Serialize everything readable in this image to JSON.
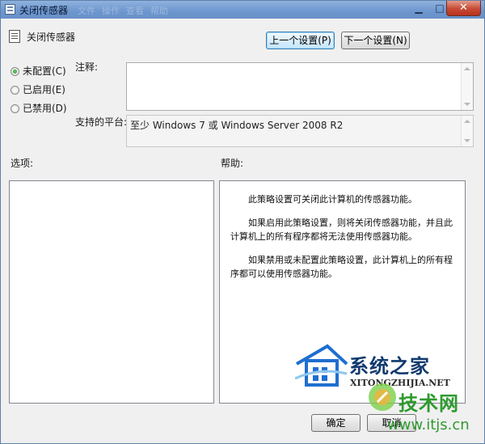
{
  "window": {
    "title": "关闭传感器",
    "ghost_menus": [
      "文件",
      "操作",
      "查看",
      "帮助"
    ],
    "controls": {
      "minimize": "▁",
      "maximize": "□",
      "close": "✕"
    }
  },
  "header": {
    "title": "关闭传感器",
    "prev_button": "上一个设置(P)",
    "next_button": "下一个设置(N)"
  },
  "state_options": [
    {
      "label": "未配置(C)",
      "checked": true
    },
    {
      "label": "已启用(E)",
      "checked": false
    },
    {
      "label": "已禁用(D)",
      "checked": false
    }
  ],
  "comment_label": "注释:",
  "comment_value": "",
  "platform_label": "支持的平台:",
  "platform_value": "至少 Windows 7 或 Windows Server 2008 R2",
  "options_label": "选项:",
  "help_label": "帮助:",
  "help_paragraphs": [
    "此策略设置可关闭此计算机的传感器功能。",
    "如果启用此策略设置，则将关闭传感器功能，并且此计算机上的所有程序都将无法使用传感器功能。",
    "如果禁用或未配置此策略设置，此计算机上的所有程序都可以使用传感器功能。"
  ],
  "footer": {
    "ok_button": "确定",
    "cancel_button": "取消"
  },
  "watermark": {
    "brand": "系统之家",
    "site": "XITONGZHIJIA.NET",
    "brand2": "技术网",
    "url2": "www.itjs.cn"
  },
  "colors": {
    "titlebar": "#6c96cf",
    "close_button": "#c74a35",
    "radio_checked": "#1e8e1e",
    "watermark_blue": "#123a6e",
    "watermark_green": "#2f9a2f"
  }
}
